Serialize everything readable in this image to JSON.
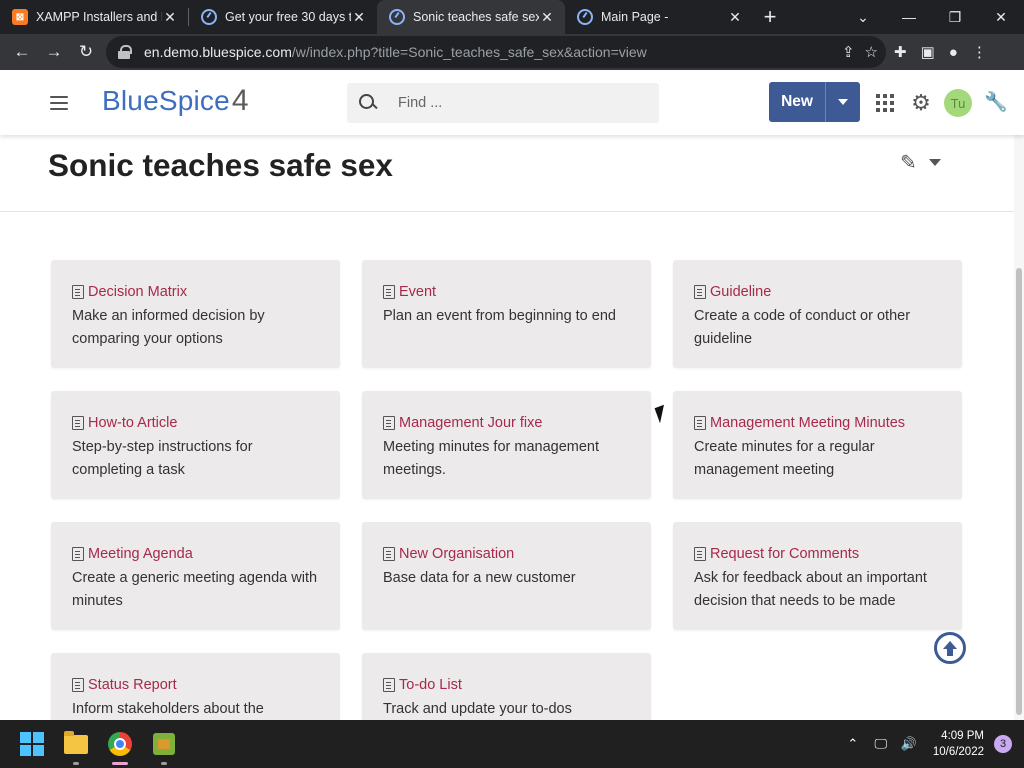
{
  "browser": {
    "tabs": [
      {
        "title": "XAMPP Installers and D",
        "favicon": "xampp-icon",
        "active": false
      },
      {
        "title": "Get your free 30 days t",
        "favicon": "bluespice-icon",
        "active": false
      },
      {
        "title": "Sonic teaches safe sex",
        "favicon": "bluespice-icon",
        "active": true
      },
      {
        "title": "Main Page -",
        "favicon": "bluespice-icon",
        "active": false
      }
    ],
    "url_host": "en.demo.bluespice.com",
    "url_path": "/w/index.php?title=Sonic_teaches_safe_sex&action=view"
  },
  "header": {
    "logo_text": "BlueSpice",
    "logo_version": "4",
    "search_placeholder": "Find ...",
    "new_button_label": "New",
    "avatar_initials": "Tu"
  },
  "page": {
    "title": "Sonic teaches safe sex"
  },
  "cards": [
    {
      "title": "Decision Matrix",
      "description": "Make an informed decision by comparing your options"
    },
    {
      "title": "Event",
      "description": "Plan an event from beginning to end"
    },
    {
      "title": "Guideline",
      "description": "Create a code of conduct or other guideline"
    },
    {
      "title": "How-to Article",
      "description": "Step-by-step instructions for completing a task"
    },
    {
      "title": "Management Jour fixe",
      "description": "Meeting minutes for management meetings."
    },
    {
      "title": "Management Meeting Minutes",
      "description": "Create minutes for a regular management meeting"
    },
    {
      "title": "Meeting Agenda",
      "description": "Create a generic meeting agenda with minutes"
    },
    {
      "title": "New Organisation",
      "description": "Base data for a new customer"
    },
    {
      "title": "Request for Comments",
      "description": "Ask for feedback about an important decision that needs to be made"
    },
    {
      "title": "Status Report",
      "description": "Inform stakeholders about the"
    },
    {
      "title": "To-do List",
      "description": "Track and update your to-dos"
    }
  ],
  "taskbar": {
    "time": "4:09 PM",
    "date": "10/6/2022",
    "notification_count": "3"
  },
  "colors": {
    "accent": "#3e5a95",
    "link": "#a7294b",
    "card_bg": "#eceaeb"
  }
}
